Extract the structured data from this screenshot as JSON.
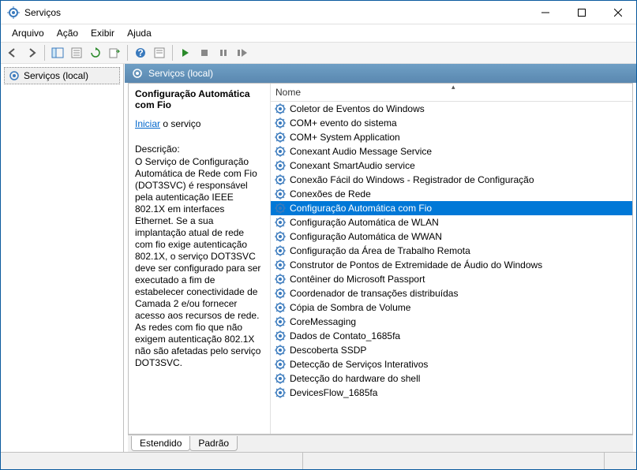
{
  "window": {
    "title": "Serviços"
  },
  "menu": {
    "file": "Arquivo",
    "action": "Ação",
    "view": "Exibir",
    "help": "Ajuda"
  },
  "left": {
    "root": "Serviços (local)"
  },
  "header": {
    "title": "Serviços (local)"
  },
  "detail": {
    "service_name": "Configuração Automática com Fio",
    "start_label": "Iniciar",
    "start_suffix": " o serviço",
    "desc_label": "Descrição:",
    "desc_text": "O Serviço de Configuração Automática de Rede com Fio (DOT3SVC) é responsável pela autenticação IEEE 802.1X em interfaces Ethernet. Se a sua implantação atual de rede com fio exige autenticação 802.1X, o serviço DOT3SVC deve ser configurado para ser executado a fim de estabelecer conectividade de Camada 2 e/ou fornecer acesso aos recursos de rede. As redes com fio que não exigem autenticação 802.1X não são afetadas pelo serviço DOT3SVC."
  },
  "list": {
    "col_name": "Nome",
    "items": [
      "Coletor de Eventos do Windows",
      "COM+ evento do sistema",
      "COM+ System Application",
      "Conexant Audio Message Service",
      "Conexant SmartAudio service",
      "Conexão Fácil do Windows - Registrador de Configuração",
      "Conexões de Rede",
      "Configuração Automática com Fio",
      "Configuração Automática de WLAN",
      "Configuração Automática de WWAN",
      "Configuração da Área de Trabalho Remota",
      "Construtor de Pontos de Extremidade de Áudio do Windows",
      "Contêiner do Microsoft Passport",
      "Coordenador de transações distribuídas",
      "Cópia de Sombra de Volume",
      "CoreMessaging",
      "Dados de Contato_1685fa",
      "Descoberta SSDP",
      "Detecção de Serviços Interativos",
      "Detecção do hardware do shell",
      "DevicesFlow_1685fa"
    ],
    "selected_index": 7
  },
  "tabs": {
    "extended": "Estendido",
    "standard": "Padrão"
  }
}
